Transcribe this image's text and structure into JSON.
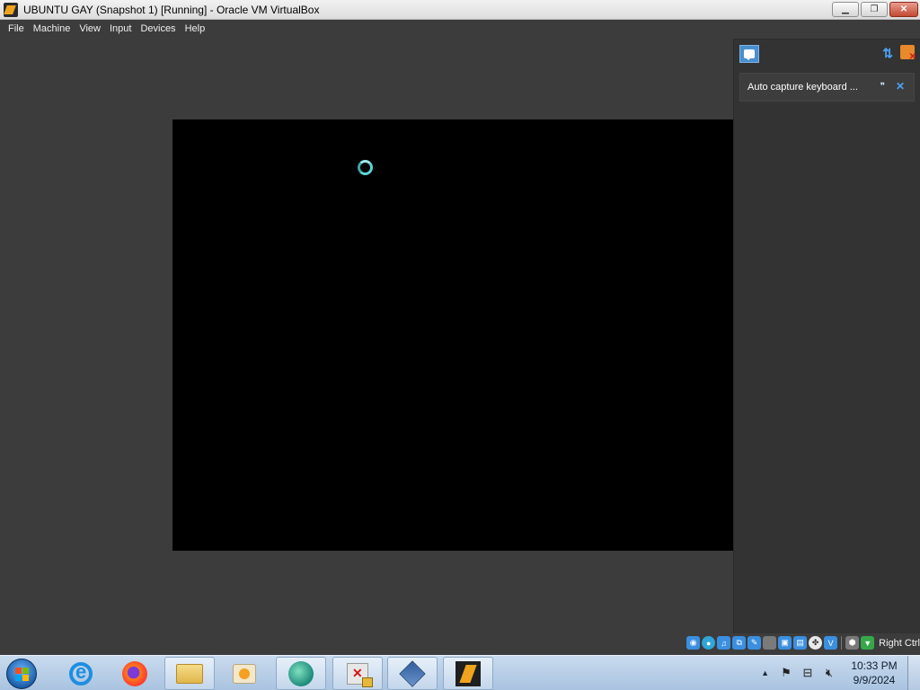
{
  "window": {
    "title": "UBUNTU GAY (Snapshot 1) [Running] - Oracle VM VirtualBox",
    "minimize_label": "▁",
    "restore_label": "❐",
    "close_label": "✕"
  },
  "menubar": {
    "items": [
      "File",
      "Machine",
      "View",
      "Input",
      "Devices",
      "Help"
    ]
  },
  "notification_center": {
    "messages": [
      {
        "text": "Auto capture keyboard ...",
        "help_icon": "chat-bubbles-icon",
        "close_icon": "close-icon"
      }
    ]
  },
  "statusbar": {
    "host_key": "Right Ctrl"
  },
  "taskbar": {
    "clock_time": "10:33 PM",
    "clock_date": "9/9/2024"
  },
  "colors": {
    "vm_background": "#3c3c3c",
    "screen": "#000000",
    "spinner": "#5fd3d6",
    "accent": "#4a8fcf"
  }
}
